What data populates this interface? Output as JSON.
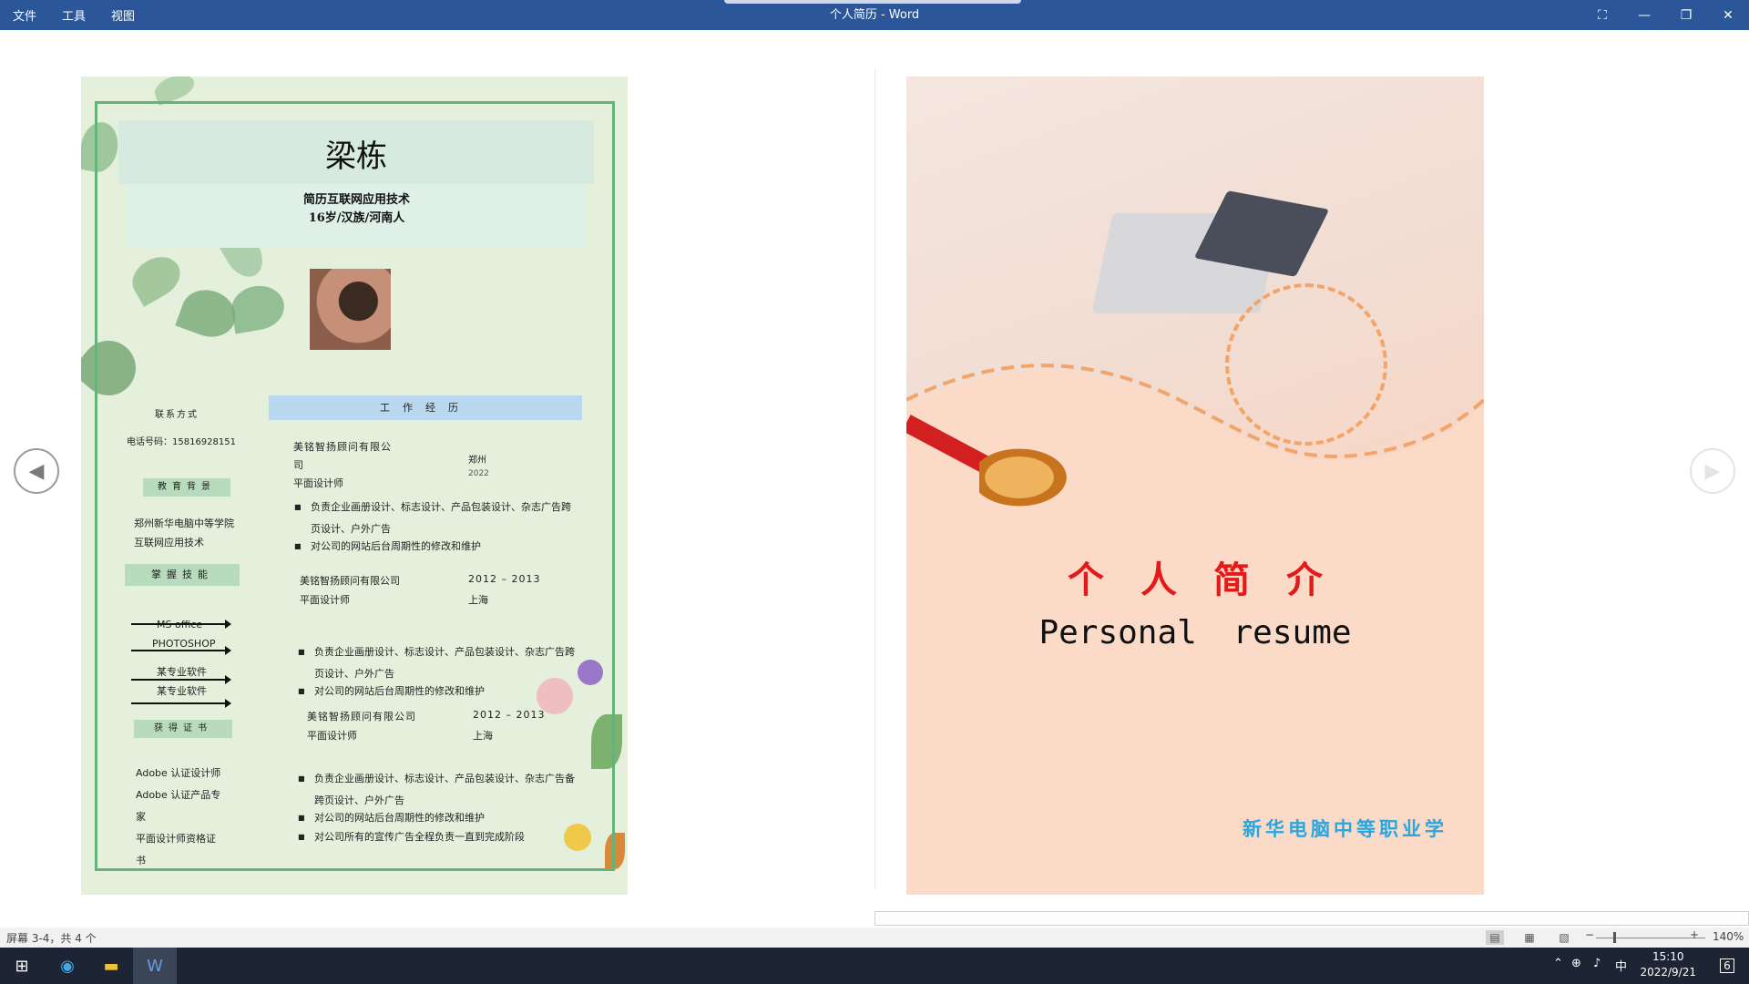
{
  "window": {
    "title": "个人简历 - Word",
    "menu": [
      "文件",
      "工具",
      "视图"
    ],
    "controls": {
      "focus": "⛶",
      "minimize": "—",
      "restore": "❐",
      "close": "✕"
    }
  },
  "navigation": {
    "prev": "◀",
    "next": "▶"
  },
  "resume": {
    "name": "梁栋",
    "info_line1": "简历互联网应用技术",
    "info_line2": "16岁/汉族/河南人",
    "contact_title": "联系方式",
    "phone": "电话号码：15816928151",
    "education_title": "教育背景",
    "education_school": "郑州新华电脑中等学院",
    "education_major": "互联网应用技术",
    "skills_title": "掌握技能",
    "skills": [
      "MS office",
      "PHOTOSHOP",
      "某专业软件",
      "某专业软件"
    ],
    "cert_title": "获得证书",
    "certs": [
      "Adobe 认证设计师",
      "Adobe 认证产品专",
      "家",
      "平面设计师资格证",
      "书"
    ],
    "work_title": "工作经历",
    "jobs": [
      {
        "company": "美铭智扬顾问有限公",
        "company2": "司",
        "role": "平面设计师",
        "city": "郑州",
        "year": "2022"
      },
      {
        "company": "美铭智扬顾问有限公司",
        "role": "平面设计师",
        "year": "2012 – 2013",
        "city": "上海"
      },
      {
        "company": "美铭智扬顾问有限公司",
        "role": "平面设计师",
        "year": "2012 – 2013",
        "city": "上海"
      }
    ],
    "bullets_a": [
      "负责企业画册设计、标志设计、产品包装设计、杂志广告跨",
      "页设计、户外广告",
      "对公司的网站后台周期性的修改和维护"
    ],
    "bullets_b": [
      "负责企业画册设计、标志设计、产品包装设计、杂志广告跨",
      "页设计、户外广告",
      "对公司的网站后台周期性的修改和维护"
    ],
    "bullets_c": [
      "负责企业画册设计、标志设计、产品包装设计、杂志广告备",
      "跨页设计、户外广告",
      "对公司的网站后台周期性的修改和维护",
      "对公司所有的宣传广告全程负责一直到完成阶段"
    ]
  },
  "cover": {
    "title": "个人简介",
    "subtitle": "Personal resume",
    "school": "新华电脑中等职业学"
  },
  "status": {
    "page_info": "屏幕 3-4，共 4 个",
    "zoom": "140%",
    "zoom_minus": "−",
    "zoom_plus": "+"
  },
  "taskbar": {
    "time": "15:10",
    "date": "2022/9/21",
    "ime": "中",
    "notifications": "6"
  },
  "colors": {
    "titlebar": "#2b579a",
    "cover_title": "#e31a1a",
    "school": "#29a6de",
    "frame": "#65b27a"
  }
}
